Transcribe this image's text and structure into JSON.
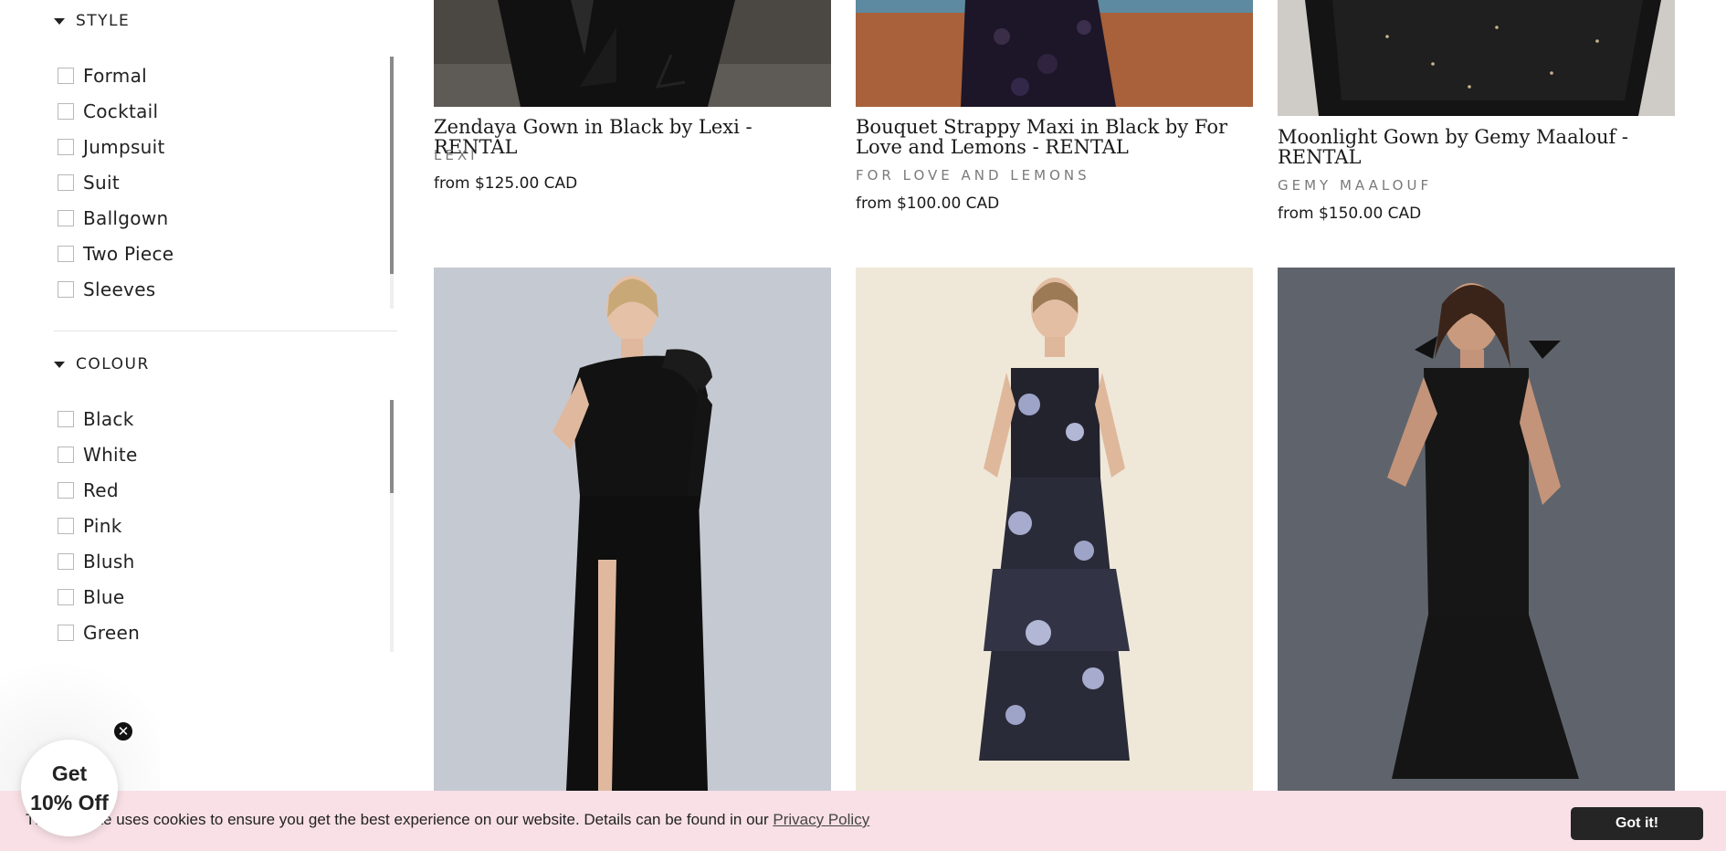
{
  "filters": {
    "style": {
      "title": "STYLE",
      "items": [
        "Formal",
        "Cocktail",
        "Jumpsuit",
        "Suit",
        "Ballgown",
        "Two Piece",
        "Sleeves"
      ]
    },
    "colour": {
      "title": "COLOUR",
      "items": [
        "Black",
        "White",
        "Red",
        "Pink",
        "Blush",
        "Blue",
        "Green"
      ]
    }
  },
  "products": [
    {
      "title": "Zendaya Gown in Black by Lexi - RENTAL",
      "vendor": "LEXI",
      "price": "from $125.00 CAD"
    },
    {
      "title": "Bouquet Strappy Maxi in Black by For Love and Lemons - RENTAL",
      "vendor": "FOR LOVE AND LEMONS",
      "price": "from $100.00 CAD"
    },
    {
      "title": "Moonlight Gown by Gemy Maalouf - RENTAL",
      "vendor": "GEMY MAALOUF",
      "price": "from $150.00 CAD"
    }
  ],
  "promo": {
    "line1": "Get",
    "line2": "10% Off",
    "close_symbol": "✕"
  },
  "cookie_banner": {
    "text": "This website uses cookies to ensure you get the best experience on our website. Details can be found in our",
    "link": "Privacy Policy",
    "button": "Got it!"
  },
  "colors": {
    "cookie_bg": "#f8e0e6",
    "button_bg": "#252525",
    "text": "#222222"
  }
}
